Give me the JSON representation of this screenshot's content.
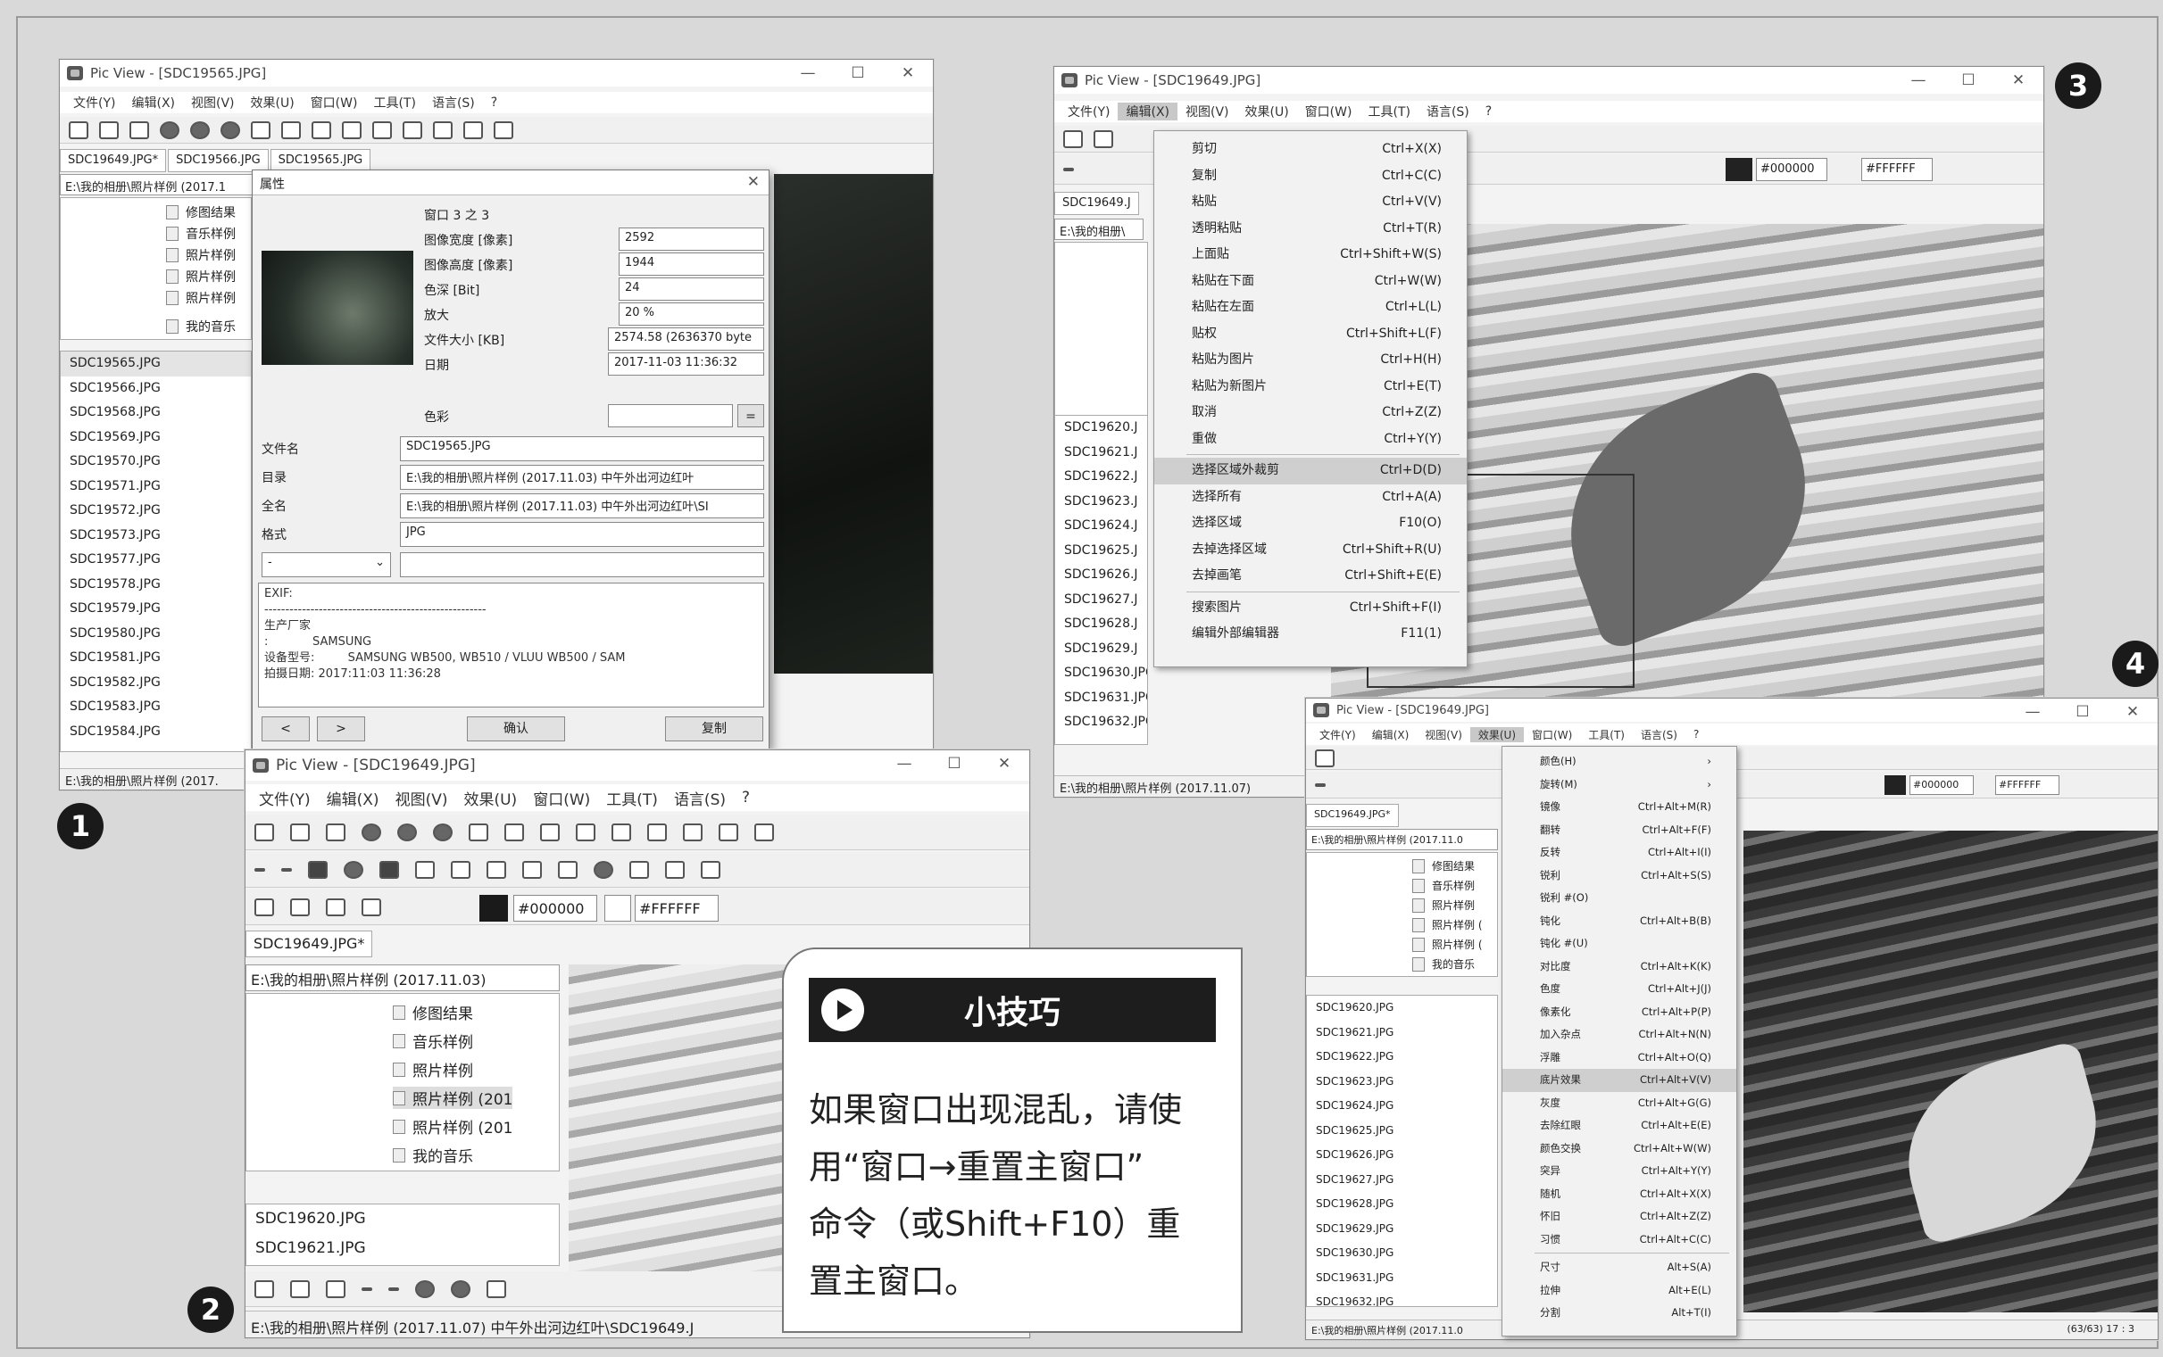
{
  "common": {
    "app_title_a": "Pic View - [SDC19565.JPG]",
    "app_title_b": "Pic View - [SDC19649.JPG]",
    "menu": [
      "文件(Y)",
      "编辑(X)",
      "视图(V)",
      "效果(U)",
      "窗口(W)",
      "工具(T)",
      "语言(S)",
      "?"
    ],
    "min": "—",
    "max": "☐",
    "close": "✕"
  },
  "badges": [
    "1",
    "2",
    "3",
    "4"
  ],
  "win1": {
    "tabs": [
      "SDC19649.JPG*",
      "SDC19566.JPG",
      "SDC19565.JPG"
    ],
    "path": "E:\\我的相册\\照片样例 (2017.1",
    "tree": [
      "修图结果",
      "音乐样例",
      "照片样例",
      "照片样例",
      "照片样例",
      "我的音乐"
    ],
    "files": [
      "SDC19565.JPG",
      "SDC19566.JPG",
      "SDC19568.JPG",
      "SDC19569.JPG",
      "SDC19570.JPG",
      "SDC19571.JPG",
      "SDC19572.JPG",
      "SDC19573.JPG",
      "SDC19577.JPG",
      "SDC19578.JPG",
      "SDC19579.JPG",
      "SDC19580.JPG",
      "SDC19581.JPG",
      "SDC19582.JPG",
      "SDC19583.JPG",
      "SDC19584.JPG"
    ],
    "status": "E:\\我的相册\\照片样例 (2017."
  },
  "props": {
    "title": "属性",
    "count": "窗口 3 之 3",
    "fields": [
      {
        "label": "图像宽度 [像素]",
        "value": "2592"
      },
      {
        "label": "图像高度 [像素]",
        "value": "1944"
      },
      {
        "label": "色深 [Bit]",
        "value": "24"
      },
      {
        "label": "放大",
        "value": "20 %"
      },
      {
        "label": "文件大小 [KB]",
        "value": "2574.58 (2636370 byte"
      },
      {
        "label": "日期",
        "value": "2017-11-03 11:36:32"
      },
      {
        "label": "色彩",
        "value": ""
      }
    ],
    "color_btn": "=",
    "file": [
      {
        "label": "文件名",
        "value": "SDC19565.JPG"
      },
      {
        "label": "目录",
        "value": "E:\\我的相册\\照片样例 (2017.11.03) 中午外出河边红叶"
      },
      {
        "label": "全名",
        "value": "E:\\我的相册\\照片样例 (2017.11.03) 中午外出河边红叶\\SI"
      },
      {
        "label": "格式",
        "value": "JPG"
      }
    ],
    "select": "-",
    "exif_lines": [
      "EXIF:",
      "-----------------------------------------------------",
      "生产厂家",
      ":            SAMSUNG",
      "设备型号:         SAMSUNG WB500, WB510 / VLUU WB500 / SAM",
      "拍摄日期: 2017:11:03 11:36:28"
    ],
    "prev": "<",
    "next": ">",
    "ok": "确认",
    "copy": "复制"
  },
  "win2": {
    "colors": {
      "fg": "#000000",
      "bg": "#FFFFFF"
    },
    "tab": "SDC19649.JPG*",
    "path": "E:\\我的相册\\照片样例 (2017.11.03)",
    "tree": [
      "修图结果",
      "音乐样例",
      "照片样例",
      "照片样例 (201",
      "照片样例 (201",
      "我的音乐"
    ],
    "files": [
      "SDC19620.JPG",
      "SDC19621.JPG"
    ],
    "status": "E:\\我的相册\\照片样例 (2017.11.07) 中午外出河边红叶\\SDC19649.J"
  },
  "win3": {
    "tab": "SDC19649.J",
    "path": "E:\\我的相册\\",
    "files": [
      "SDC19620.J",
      "SDC19621.J",
      "SDC19622.J",
      "SDC19623.J",
      "SDC19624.J",
      "SDC19625.J",
      "SDC19626.J",
      "SDC19627.J",
      "SDC19628.J",
      "SDC19629.J",
      "SDC19630.JPG",
      "SDC19631.JPG",
      "SDC19632.JPG"
    ],
    "colors": {
      "fg": "#000000",
      "bg": "#FFFFFF"
    },
    "status": "E:\\我的相册\\照片样例 (2017.11.07)",
    "edit_menu": [
      {
        "label": "剪切",
        "key": "Ctrl+X(X)"
      },
      {
        "label": "复制",
        "key": "Ctrl+C(C)"
      },
      {
        "label": "粘贴",
        "key": "Ctrl+V(V)"
      },
      {
        "label": "透明粘贴",
        "key": "Ctrl+T(R)"
      },
      {
        "label": "上面贴",
        "key": "Ctrl+Shift+W(S)"
      },
      {
        "label": "粘贴在下面",
        "key": "Ctrl+W(W)"
      },
      {
        "label": "粘贴在左面",
        "key": "Ctrl+L(L)"
      },
      {
        "label": "贴权",
        "key": "Ctrl+Shift+L(F)"
      },
      {
        "label": "粘贴为图片",
        "key": "Ctrl+H(H)"
      },
      {
        "label": "粘贴为新图片",
        "key": "Ctrl+E(T)"
      },
      {
        "label": "取消",
        "key": "Ctrl+Z(Z)"
      },
      {
        "label": "重做",
        "key": "Ctrl+Y(Y)"
      },
      {
        "label": "选择区域外裁剪",
        "key": "Ctrl+D(D)"
      },
      {
        "label": "选择所有",
        "key": "Ctrl+A(A)"
      },
      {
        "label": "选择区域",
        "key": "F10(O)"
      },
      {
        "label": "去掉选择区域",
        "key": "Ctrl+Shift+R(U)"
      },
      {
        "label": "去掉画笔",
        "key": "Ctrl+Shift+E(E)"
      },
      {
        "label": "搜索图片",
        "key": "Ctrl+Shift+F(I)"
      },
      {
        "label": "编辑外部编辑器",
        "key": "F11(1)"
      }
    ]
  },
  "win4": {
    "tab": "SDC19649.JPG*",
    "path": "E:\\我的相册\\照片样例 (2017.11.0",
    "tree": [
      "修图结果",
      "音乐样例",
      "照片样例",
      "照片样例 (",
      "照片样例 (",
      "我的音乐"
    ],
    "files": [
      "SDC19620.JPG",
      "SDC19621.JPG",
      "SDC19622.JPG",
      "SDC19623.JPG",
      "SDC19624.JPG",
      "SDC19625.JPG",
      "SDC19626.JPG",
      "SDC19627.JPG",
      "SDC19628.JPG",
      "SDC19629.JPG",
      "SDC19630.JPG",
      "SDC19631.JPG",
      "SDC19632.JPG"
    ],
    "colors": {
      "fg": "#000000",
      "bg": "#FFFFFF"
    },
    "status": "E:\\我的相册\\照片样例 (2017.11.0",
    "status_right": "(63/63)      17 : 3",
    "effect_menu": [
      {
        "label": "颜色(H)",
        "key": "›"
      },
      {
        "label": "旋转(M)",
        "key": "›"
      },
      {
        "label": "镜像",
        "key": "Ctrl+Alt+M(R)"
      },
      {
        "label": "翻转",
        "key": "Ctrl+Alt+F(F)"
      },
      {
        "label": "反转",
        "key": "Ctrl+Alt+I(I)"
      },
      {
        "label": "锐利",
        "key": "Ctrl+Alt+S(S)"
      },
      {
        "label": "锐利 #(O)",
        "key": ""
      },
      {
        "label": "钝化",
        "key": "Ctrl+Alt+B(B)"
      },
      {
        "label": "钝化 #(U)",
        "key": ""
      },
      {
        "label": "对比度",
        "key": "Ctrl+Alt+K(K)"
      },
      {
        "label": "色度",
        "key": "Ctrl+Alt+J(J)"
      },
      {
        "label": "像素化",
        "key": "Ctrl+Alt+P(P)"
      },
      {
        "label": "加入杂点",
        "key": "Ctrl+Alt+N(N)"
      },
      {
        "label": "浮雕",
        "key": "Ctrl+Alt+O(Q)"
      },
      {
        "label": "底片效果",
        "key": "Ctrl+Alt+V(V)"
      },
      {
        "label": "灰度",
        "key": "Ctrl+Alt+G(G)"
      },
      {
        "label": "去除红眼",
        "key": "Ctrl+Alt+E(E)"
      },
      {
        "label": "颜色交换",
        "key": "Ctrl+Alt+W(W)"
      },
      {
        "label": "突异",
        "key": "Ctrl+Alt+Y(Y)"
      },
      {
        "label": "随机",
        "key": "Ctrl+Alt+X(X)"
      },
      {
        "label": "怀旧",
        "key": "Ctrl+Alt+Z(Z)"
      },
      {
        "label": "习惯",
        "key": "Ctrl+Alt+C(C)"
      },
      {
        "label": "尺寸",
        "key": "Alt+S(A)"
      },
      {
        "label": "拉伸",
        "key": "Alt+E(L)"
      },
      {
        "label": "分割",
        "key": "Alt+T(I)"
      }
    ]
  },
  "tip": {
    "title": "小技巧",
    "lines": [
      "如果窗口出现混乱，请使",
      "用“窗口→重置主窗口”",
      "命令（或Shift+F10）重",
      "置主窗口。"
    ]
  }
}
